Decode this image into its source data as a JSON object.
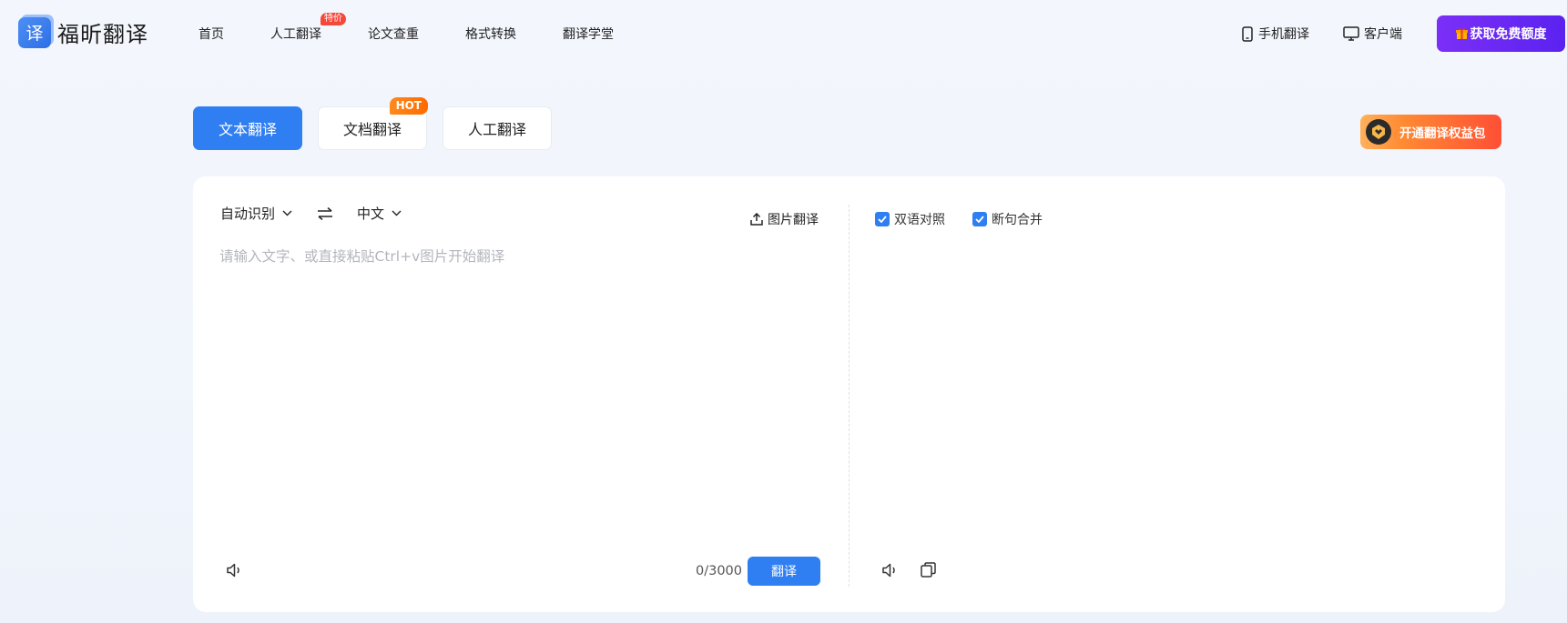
{
  "header": {
    "logo_glyph": "译",
    "logo_text": "福昕翻译",
    "nav": [
      {
        "label": "首页"
      },
      {
        "label": "人工翻译",
        "badge": "特价"
      },
      {
        "label": "论文查重"
      },
      {
        "label": "格式转换"
      },
      {
        "label": "翻译学堂"
      }
    ],
    "mobile_label": "手机翻译",
    "client_label": "客户端",
    "quota_label": "获取免费额度",
    "quota_icon": "gift-icon"
  },
  "tabs": [
    {
      "label": "文本翻译",
      "active": true
    },
    {
      "label": "文档翻译",
      "badge": "HOT"
    },
    {
      "label": "人工翻译"
    }
  ],
  "vip_button": {
    "label": "开通翻译权益包",
    "icon": "vip-shield-icon"
  },
  "source": {
    "lang_from": "自动识别",
    "lang_to": "中文",
    "image_translate_label": "图片翻译",
    "placeholder": "请输入文字、或直接粘贴Ctrl+v图片开始翻译",
    "value": "",
    "counter": "0/3000",
    "translate_button": "翻译"
  },
  "target": {
    "options": [
      {
        "label": "双语对照",
        "checked": true
      },
      {
        "label": "断句合并",
        "checked": true
      }
    ]
  },
  "colors": {
    "primary": "#2f7ff2",
    "quota_gradient": [
      "#7b2ff7",
      "#5b22f0"
    ],
    "hot_badge": "#ff7a10",
    "sale_badge": "#f5483b"
  }
}
